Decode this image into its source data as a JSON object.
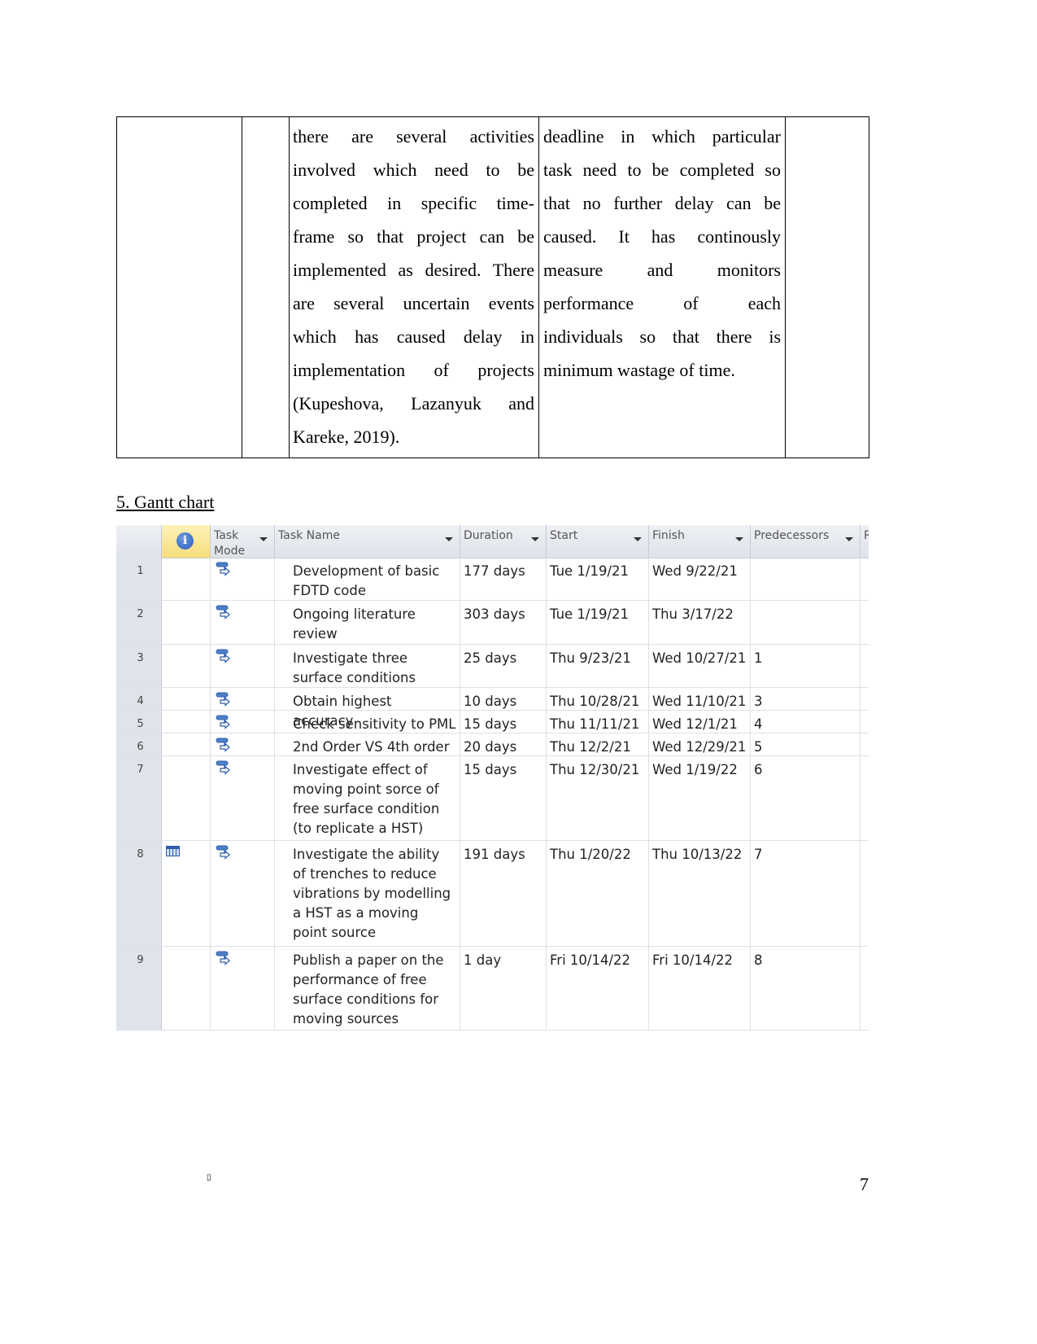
{
  "prose_table": {
    "col3_lines": [
      "there are several activities",
      "involved which need to be",
      "completed in specific time-",
      "frame so that project can be",
      "implemented as desired. There",
      "are several uncertain events",
      "which has caused delay in",
      "implementation of projects",
      "(Kupeshova, Lazanyuk and",
      "Kareke, 2019)."
    ],
    "col4_lines": [
      "deadline in which particular",
      "task need to be completed so",
      "that no further delay can be",
      "caused. It has continously",
      "measure and monitors",
      "performance of each",
      "individuals so that there is",
      "minimum wastage of time."
    ]
  },
  "section_heading": "5. Gantt chart",
  "gantt": {
    "headers": {
      "info": "i",
      "mode": "Task Mode",
      "name": "Task Name",
      "duration": "Duration",
      "start": "Start",
      "finish": "Finish",
      "predecessors": "Predecessors",
      "next": "R"
    },
    "colors": {
      "header_bg": "#dfe3ea",
      "info_header_bg": "#f7dd7c",
      "icon_blue": "#2f5ea8"
    },
    "rows": [
      {
        "id": "1",
        "indicator": "",
        "mode_icon": "auto-scheduled-icon",
        "name": "Development of basic FDTD code",
        "duration": "177 days",
        "start": "Tue 1/19/21",
        "finish": "Wed 9/22/21",
        "predecessors": ""
      },
      {
        "id": "2",
        "indicator": "",
        "mode_icon": "auto-scheduled-icon",
        "name": "Ongoing literature review",
        "duration": "303 days",
        "start": "Tue 1/19/21",
        "finish": "Thu 3/17/22",
        "predecessors": ""
      },
      {
        "id": "3",
        "indicator": "",
        "mode_icon": "auto-scheduled-icon",
        "name": "Investigate three surface conditions",
        "duration": "25 days",
        "start": "Thu 9/23/21",
        "finish": "Wed 10/27/21",
        "predecessors": "1"
      },
      {
        "id": "4",
        "indicator": "",
        "mode_icon": "auto-scheduled-icon",
        "name": "Obtain highest accuracy",
        "duration": "10 days",
        "start": "Thu 10/28/21",
        "finish": "Wed 11/10/21",
        "predecessors": "3"
      },
      {
        "id": "5",
        "indicator": "",
        "mode_icon": "auto-scheduled-icon",
        "name": "Check sensitivity to PML",
        "duration": "15 days",
        "start": "Thu 11/11/21",
        "finish": "Wed 12/1/21",
        "predecessors": "4"
      },
      {
        "id": "6",
        "indicator": "",
        "mode_icon": "auto-scheduled-icon",
        "name": "2nd Order VS 4th order",
        "duration": "20 days",
        "start": "Thu 12/2/21",
        "finish": "Wed 12/29/21",
        "predecessors": "5"
      },
      {
        "id": "7",
        "indicator": "",
        "mode_icon": "auto-scheduled-icon",
        "name": "Investigate effect of moving point sorce of free surface condition (to replicate a HST)",
        "duration": "15 days",
        "start": "Thu 12/30/21",
        "finish": "Wed 1/19/22",
        "predecessors": "6"
      },
      {
        "id": "8",
        "indicator": "calendar-icon",
        "mode_icon": "auto-scheduled-icon",
        "name": "Investigate the ability of trenches to reduce vibrations by modelling a HST as a moving point source",
        "duration": "191 days",
        "start": "Thu 1/20/22",
        "finish": "Thu 10/13/22",
        "predecessors": "7"
      },
      {
        "id": "9",
        "indicator": "",
        "mode_icon": "auto-scheduled-icon",
        "name": "Publish a paper on the performance of free surface conditions for moving sources",
        "duration": "1 day",
        "start": "Fri 10/14/22",
        "finish": "Fri 10/14/22",
        "predecessors": "8"
      }
    ]
  },
  "footer": {
    "footnote_mark": "▯",
    "page_number": "7"
  }
}
